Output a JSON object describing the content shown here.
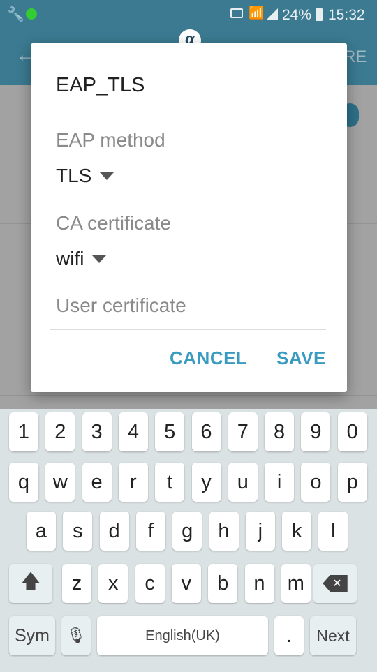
{
  "status_bar": {
    "battery": "24%",
    "time": "15:32",
    "icons": [
      "wrench-icon",
      "ping-icon",
      "cast-icon",
      "wifi-icon",
      "signal-icon",
      "battery-charging-icon"
    ]
  },
  "app_bar": {
    "back_icon": "arrow-left-icon",
    "action_partial": "RE"
  },
  "overlay_logo": "α",
  "dialog": {
    "title": "EAP_TLS",
    "eap_method_label": "EAP method",
    "eap_method_value": "TLS",
    "ca_cert_label": "CA certificate",
    "ca_cert_value": "wifi",
    "user_cert_label": "User certificate",
    "cancel": "CANCEL",
    "save": "SAVE"
  },
  "keyboard": {
    "rows": [
      [
        "1",
        "2",
        "3",
        "4",
        "5",
        "6",
        "7",
        "8",
        "9",
        "0"
      ],
      [
        "q",
        "w",
        "e",
        "r",
        "t",
        "y",
        "u",
        "i",
        "o",
        "p"
      ],
      [
        "a",
        "s",
        "d",
        "f",
        "g",
        "h",
        "j",
        "k",
        "l"
      ],
      [
        "z",
        "x",
        "c",
        "v",
        "b",
        "n",
        "m"
      ]
    ],
    "shift_icon": "shift-arrow-icon",
    "backspace_icon": "backspace-icon",
    "sym": "Sym",
    "mic_icon": "microphone-icon",
    "space": "English(UK)",
    "period": ".",
    "next": "Next"
  },
  "colors": {
    "accent": "#3a9bc1",
    "app_bar": "#3b7a91"
  }
}
